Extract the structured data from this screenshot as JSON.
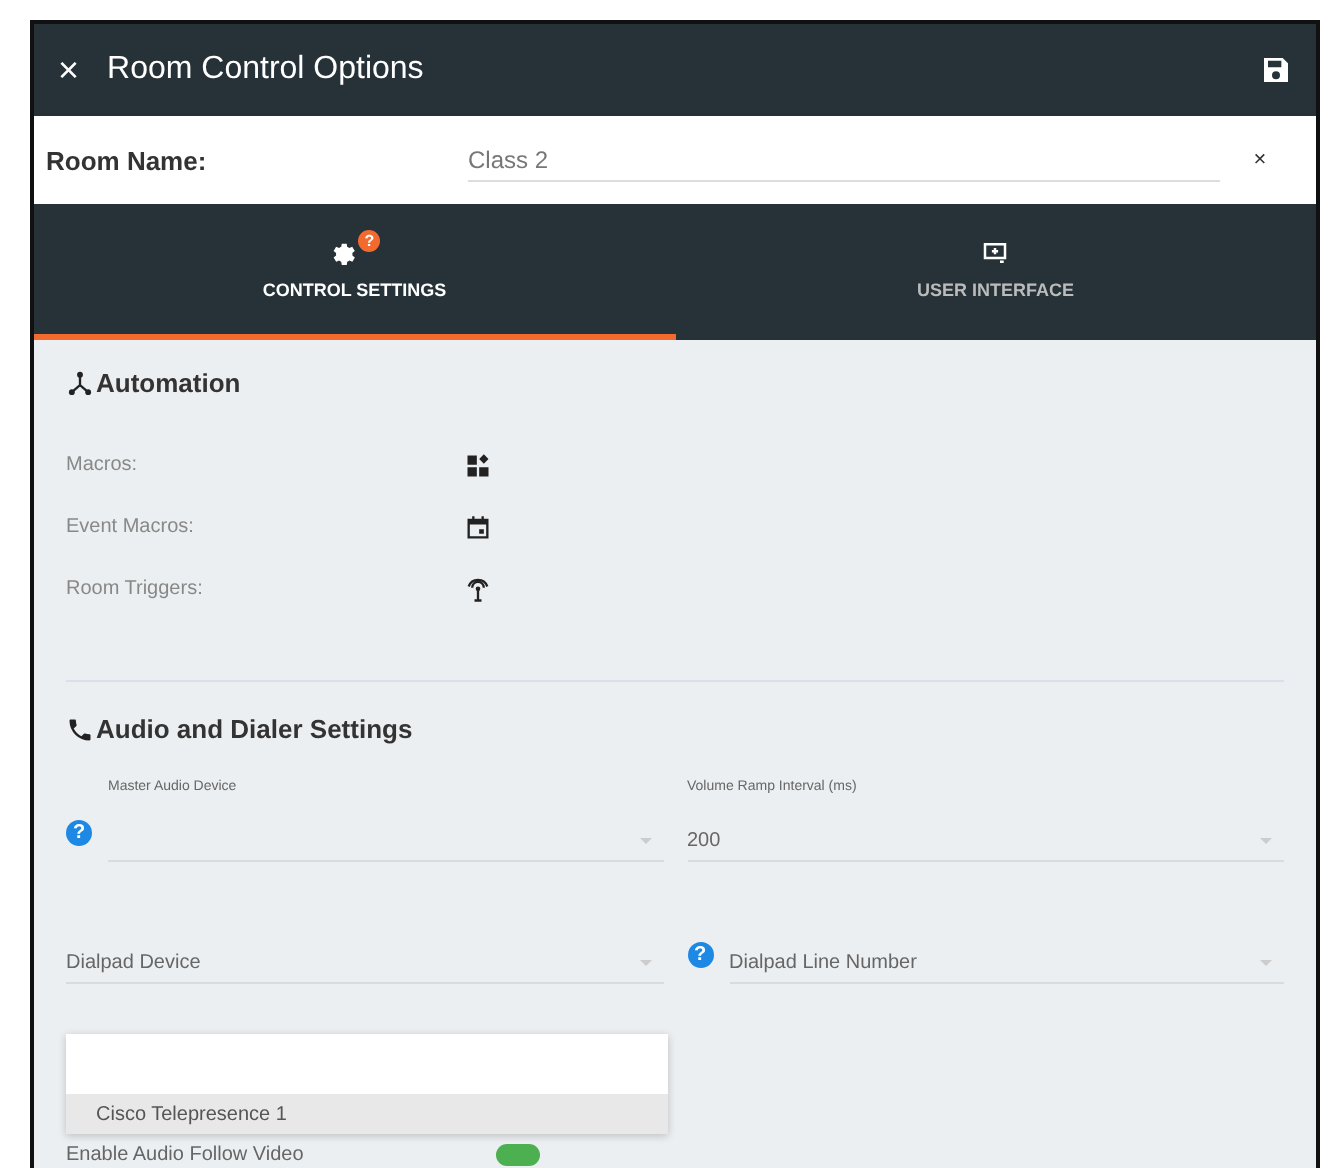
{
  "window": {
    "title": "Room Control Options",
    "close": "×"
  },
  "room_name": {
    "label": "Room Name:",
    "value": "Class 2",
    "clear": "×"
  },
  "tabs": [
    {
      "label": "CONTROL SETTINGS",
      "kind": "gear",
      "badge": "?",
      "selected": true
    },
    {
      "label": "USER INTERFACE",
      "kind": "screen",
      "selected": false
    }
  ],
  "automation": {
    "title": "Automation",
    "rows": [
      {
        "label": "Macros:",
        "kind": "macros"
      },
      {
        "label": "Event Macros:",
        "kind": "calendar"
      },
      {
        "label": "Room Triggers:",
        "kind": "antenna"
      }
    ]
  },
  "audio": {
    "title": "Audio and Dialer Settings",
    "fields": [
      {
        "label": "Master Audio Device",
        "help": "?"
      },
      {
        "label": "Volume Ramp Interval (ms)",
        "value": "200"
      },
      {
        "placeholder": "Dialpad Device"
      },
      {
        "placeholder": "Dialpad Line Number",
        "help": "?"
      }
    ],
    "toggle": {
      "label": "Enable Audio Follow Video",
      "on": true
    }
  },
  "dropdown": {
    "items": [
      {
        "label": "Cisco Telepresence 1",
        "selected": true
      }
    ]
  }
}
